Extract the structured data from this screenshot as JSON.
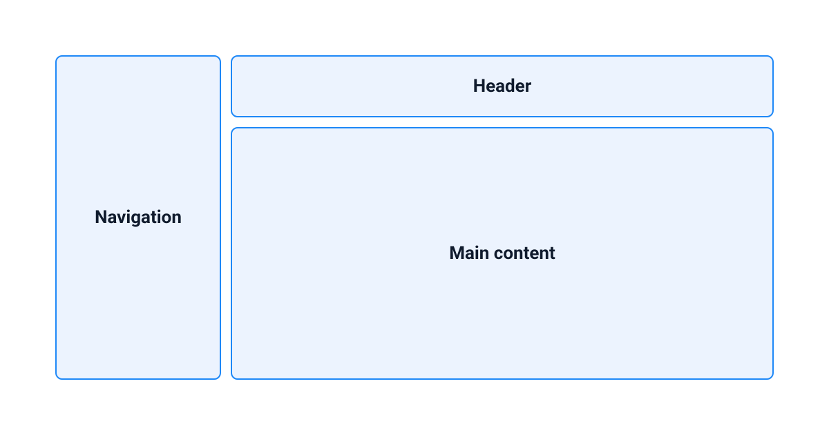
{
  "layout": {
    "navigation_label": "Navigation",
    "header_label": "Header",
    "main_content_label": "Main content"
  },
  "colors": {
    "panel_bg": "#ecf3fe",
    "panel_border": "#1e88f7",
    "text": "#101b2d"
  }
}
